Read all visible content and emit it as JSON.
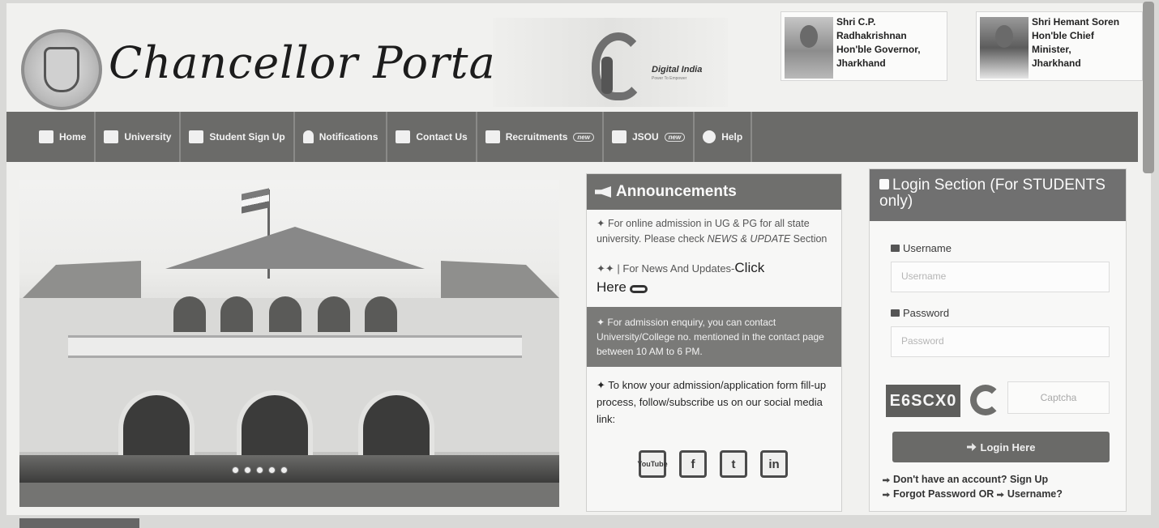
{
  "header": {
    "title": "Chancellor Portal",
    "digital_india": {
      "name": "Digital India",
      "tagline": "Power To Empower"
    },
    "governor": {
      "lines": [
        "Shri C.P.",
        "Radhakrishnan",
        "Hon'ble Governor,",
        "Jharkhand"
      ]
    },
    "chief_minister": {
      "lines": [
        "Shri Hemant Soren",
        "Hon'ble Chief",
        "Minister,",
        "Jharkhand"
      ]
    }
  },
  "nav": {
    "items": [
      {
        "label": "Home",
        "icon": "home-icon"
      },
      {
        "label": "University",
        "icon": "university-icon"
      },
      {
        "label": "Student Sign Up",
        "icon": "user-add-icon"
      },
      {
        "label": "Notifications",
        "icon": "bell-icon"
      },
      {
        "label": "Contact Us",
        "icon": "envelope-icon"
      },
      {
        "label": "Recruitments",
        "icon": "envelope-icon",
        "badge": "new"
      },
      {
        "label": "JSOU",
        "icon": "envelope-icon",
        "badge": "new"
      },
      {
        "label": "Help",
        "icon": "info-icon"
      }
    ]
  },
  "announcements": {
    "title": "Announcements",
    "items": [
      {
        "prefix": "✦ For online admission in UG & PG for all state university. Please check ",
        "em": "NEWS & UPDATE",
        "suffix": " Section"
      },
      {
        "prefix": "✦✦ | For News And Updates-",
        "click": "Click",
        "here": "Here"
      },
      {
        "text": "✦ For admission enquiry, you can contact University/College no. mentioned in the contact page between 10 AM to 6 PM."
      },
      {
        "text": "✦ To know your admission/application form fill-up process, follow/subscribe us on our social media link:"
      }
    ],
    "social": [
      "YouTube",
      "f",
      "t",
      "in"
    ]
  },
  "login": {
    "title": "Login Section (For STUDENTS only)",
    "username_label": "Username",
    "username_placeholder": "Username",
    "password_label": "Password",
    "password_placeholder": "Password",
    "captcha_code": "E6SCX0",
    "captcha_placeholder": "Captcha",
    "button": "Login Here",
    "signup_link": "Don't have an account? Sign Up",
    "forgot_link_a": "Forgot Password OR",
    "forgot_link_b": "Username?"
  }
}
